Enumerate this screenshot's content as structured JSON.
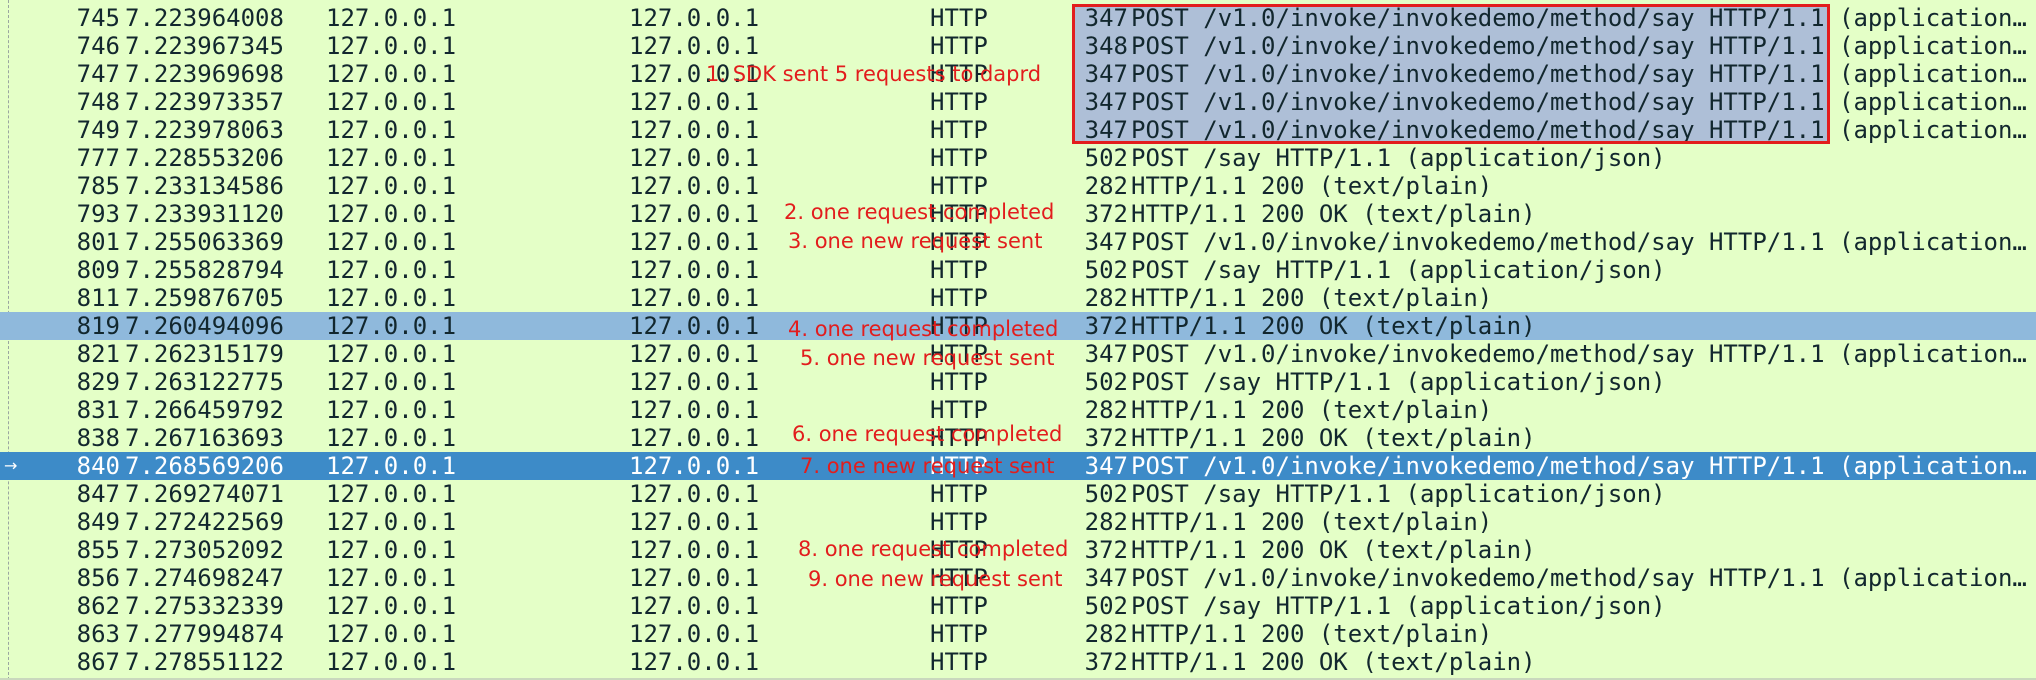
{
  "packets": [
    {
      "no": "745",
      "time": "7.223964008",
      "src": "127.0.0.1",
      "dst": "127.0.0.1",
      "proto": "HTTP",
      "len": "347",
      "info": "POST /v1.0/invoke/invokedemo/method/say HTTP/1.1  (application/json)"
    },
    {
      "no": "746",
      "time": "7.223967345",
      "src": "127.0.0.1",
      "dst": "127.0.0.1",
      "proto": "HTTP",
      "len": "348",
      "info": "POST /v1.0/invoke/invokedemo/method/say HTTP/1.1  (application/json)"
    },
    {
      "no": "747",
      "time": "7.223969698",
      "src": "127.0.0.1",
      "dst": "127.0.0.1",
      "proto": "HTTP",
      "len": "347",
      "info": "POST /v1.0/invoke/invokedemo/method/say HTTP/1.1  (application/json)"
    },
    {
      "no": "748",
      "time": "7.223973357",
      "src": "127.0.0.1",
      "dst": "127.0.0.1",
      "proto": "HTTP",
      "len": "347",
      "info": "POST /v1.0/invoke/invokedemo/method/say HTTP/1.1  (application/json)"
    },
    {
      "no": "749",
      "time": "7.223978063",
      "src": "127.0.0.1",
      "dst": "127.0.0.1",
      "proto": "HTTP",
      "len": "347",
      "info": "POST /v1.0/invoke/invokedemo/method/say HTTP/1.1  (application/json)"
    },
    {
      "no": "777",
      "time": "7.228553206",
      "src": "127.0.0.1",
      "dst": "127.0.0.1",
      "proto": "HTTP",
      "len": "502",
      "info": "POST /say HTTP/1.1  (application/json)"
    },
    {
      "no": "785",
      "time": "7.233134586",
      "src": "127.0.0.1",
      "dst": "127.0.0.1",
      "proto": "HTTP",
      "len": "282",
      "info": "HTTP/1.1 200   (text/plain)"
    },
    {
      "no": "793",
      "time": "7.233931120",
      "src": "127.0.0.1",
      "dst": "127.0.0.1",
      "proto": "HTTP",
      "len": "372",
      "info": "HTTP/1.1 200 OK  (text/plain)"
    },
    {
      "no": "801",
      "time": "7.255063369",
      "src": "127.0.0.1",
      "dst": "127.0.0.1",
      "proto": "HTTP",
      "len": "347",
      "info": "POST /v1.0/invoke/invokedemo/method/say HTTP/1.1  (application/json)"
    },
    {
      "no": "809",
      "time": "7.255828794",
      "src": "127.0.0.1",
      "dst": "127.0.0.1",
      "proto": "HTTP",
      "len": "502",
      "info": "POST /say HTTP/1.1  (application/json)"
    },
    {
      "no": "811",
      "time": "7.259876705",
      "src": "127.0.0.1",
      "dst": "127.0.0.1",
      "proto": "HTTP",
      "len": "282",
      "info": "HTTP/1.1 200   (text/plain)"
    },
    {
      "no": "819",
      "time": "7.260494096",
      "src": "127.0.0.1",
      "dst": "127.0.0.1",
      "proto": "HTTP",
      "len": "372",
      "info": "HTTP/1.1 200 OK  (text/plain)"
    },
    {
      "no": "821",
      "time": "7.262315179",
      "src": "127.0.0.1",
      "dst": "127.0.0.1",
      "proto": "HTTP",
      "len": "347",
      "info": "POST /v1.0/invoke/invokedemo/method/say HTTP/1.1  (application/json)"
    },
    {
      "no": "829",
      "time": "7.263122775",
      "src": "127.0.0.1",
      "dst": "127.0.0.1",
      "proto": "HTTP",
      "len": "502",
      "info": "POST /say HTTP/1.1  (application/json)"
    },
    {
      "no": "831",
      "time": "7.266459792",
      "src": "127.0.0.1",
      "dst": "127.0.0.1",
      "proto": "HTTP",
      "len": "282",
      "info": "HTTP/1.1 200   (text/plain)"
    },
    {
      "no": "838",
      "time": "7.267163693",
      "src": "127.0.0.1",
      "dst": "127.0.0.1",
      "proto": "HTTP",
      "len": "372",
      "info": "HTTP/1.1 200 OK  (text/plain)"
    },
    {
      "no": "840",
      "time": "7.268569206",
      "src": "127.0.0.1",
      "dst": "127.0.0.1",
      "proto": "HTTP",
      "len": "347",
      "info": "POST /v1.0/invoke/invokedemo/method/say HTTP/1.1  (application/json)"
    },
    {
      "no": "847",
      "time": "7.269274071",
      "src": "127.0.0.1",
      "dst": "127.0.0.1",
      "proto": "HTTP",
      "len": "502",
      "info": "POST /say HTTP/1.1  (application/json)"
    },
    {
      "no": "849",
      "time": "7.272422569",
      "src": "127.0.0.1",
      "dst": "127.0.0.1",
      "proto": "HTTP",
      "len": "282",
      "info": "HTTP/1.1 200   (text/plain)"
    },
    {
      "no": "855",
      "time": "7.273052092",
      "src": "127.0.0.1",
      "dst": "127.0.0.1",
      "proto": "HTTP",
      "len": "372",
      "info": "HTTP/1.1 200 OK  (text/plain)"
    },
    {
      "no": "856",
      "time": "7.274698247",
      "src": "127.0.0.1",
      "dst": "127.0.0.1",
      "proto": "HTTP",
      "len": "347",
      "info": "POST /v1.0/invoke/invokedemo/method/say HTTP/1.1  (application/json)"
    },
    {
      "no": "862",
      "time": "7.275332339",
      "src": "127.0.0.1",
      "dst": "127.0.0.1",
      "proto": "HTTP",
      "len": "502",
      "info": "POST /say HTTP/1.1  (application/json)"
    },
    {
      "no": "863",
      "time": "7.277994874",
      "src": "127.0.0.1",
      "dst": "127.0.0.1",
      "proto": "HTTP",
      "len": "282",
      "info": "HTTP/1.1 200   (text/plain)"
    },
    {
      "no": "867",
      "time": "7.278551122",
      "src": "127.0.0.1",
      "dst": "127.0.0.1",
      "proto": "HTTP",
      "len": "372",
      "info": "HTTP/1.1 200 OK  (text/plain)"
    }
  ],
  "selection": {
    "light_row": "819",
    "dark_row": "840"
  },
  "annotations": [
    "1. SDK sent 5 requests to daprd",
    "2. one request completed",
    "3. one new request sent",
    "4. one request completed",
    "5. one new request sent",
    "6. one request completed",
    "7. one new request sent",
    "8. one request completed",
    "9. one new request sent"
  ],
  "colors": {
    "background": "#e4ffc7",
    "selected_light": "#8fb9dc",
    "selected_dark": "#3d8bc8",
    "annotation": "#e21d1d",
    "highlight_fill": "#aebfd7"
  },
  "icons": {
    "current_row_marker": "arrow-right-icon"
  }
}
